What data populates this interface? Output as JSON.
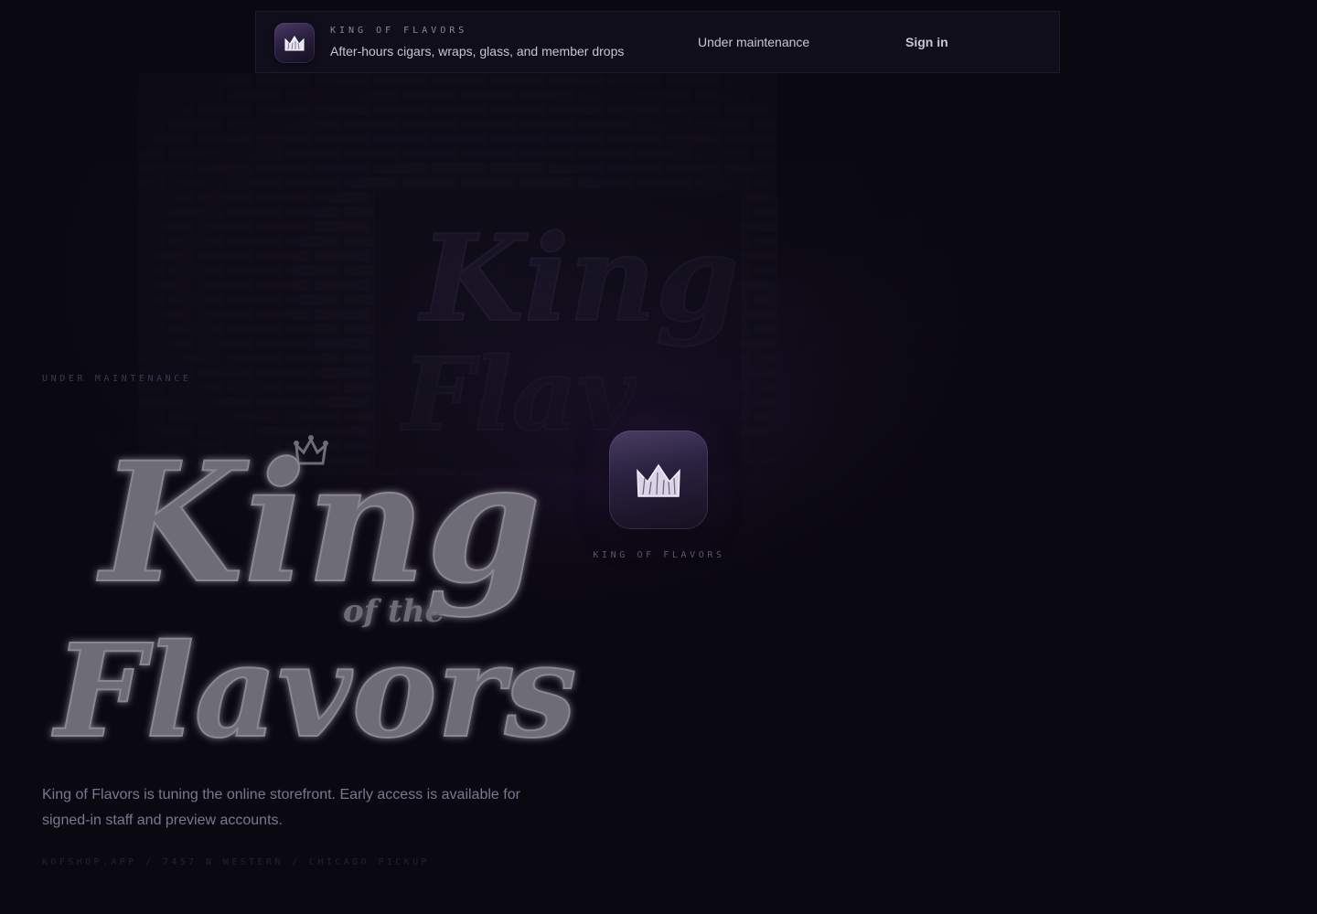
{
  "header": {
    "brand_name": "KING OF FLAVORS",
    "tagline": "After-hours cigars, wraps, glass, and member drops",
    "status_label": "Under maintenance",
    "signin_label": "Sign in",
    "brand_icon": "crown-icon"
  },
  "hero": {
    "eyebrow": "UNDER MAINTENANCE",
    "logo_word_1": "King",
    "logo_word_2": "of the",
    "logo_word_3": "Flavors",
    "description": "King of Flavors is tuning the online storefront. Early access is available for signed-in staff and preview accounts.",
    "meta": "KOFSHOP.APP / 7457 N WESTERN / CHICAGO PICKUP"
  },
  "app_card": {
    "icon": "crown-icon",
    "caption": "KING OF FLAVORS"
  },
  "colors": {
    "background": "#0a0810",
    "accent_purple": "#46226e",
    "logo_gray": "#6e6c76",
    "text_light": "#c9c5d8"
  }
}
